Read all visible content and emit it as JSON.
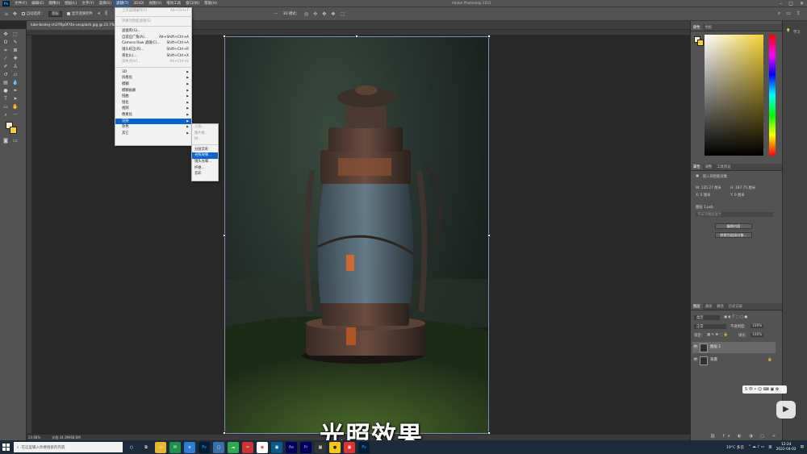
{
  "app": {
    "window_title": "Adobe Photoshop 2022",
    "logo_text": "Ps"
  },
  "menubar": [
    "文件(F)",
    "编辑(E)",
    "图像(I)",
    "图层(L)",
    "文字(Y)",
    "选择(S)",
    "滤镜(T)",
    "3D(D)",
    "视图(V)",
    "增效工具",
    "窗口(W)",
    "帮助(H)"
  ],
  "options": {
    "auto_select": "自动选择：",
    "layer_dd": "图层",
    "show_transform": "显示变换控件",
    "mode3d": "3D 模式："
  },
  "document": {
    "tab": "luke-besley-ch2YRp0f74o-unsplash.jpg @ 23.7% (图层 1, RGB/8#) *",
    "zoom": "23.68%",
    "doc_info": "文档:34.3M/68.6M"
  },
  "filter_menu": {
    "top": [
      {
        "label": "上次滤镜操作(F)",
        "shortcut": "Alt+Ctrl+F",
        "disabled": true
      },
      {
        "label": "转换为智能滤镜(S)",
        "shortcut": "",
        "disabled": true
      }
    ],
    "mid": [
      {
        "label": "滤镜库(G)...",
        "shortcut": ""
      },
      {
        "label": "自适应广角(A)...",
        "shortcut": "Alt+Shift+Ctrl+A"
      },
      {
        "label": "Camera Raw 滤镜(C)...",
        "shortcut": "Shift+Ctrl+A"
      },
      {
        "label": "镜头校正(R)...",
        "shortcut": "Shift+Ctrl+R"
      },
      {
        "label": "液化(L)...",
        "shortcut": "Shift+Ctrl+X"
      },
      {
        "label": "消失点(V)...",
        "shortcut": "Alt+Ctrl+V",
        "disabled": true
      }
    ],
    "sub": [
      "3D",
      "风格化",
      "模糊",
      "模糊画廊",
      "扭曲",
      "锐化",
      "视频",
      "像素化",
      "渲染",
      "杂色",
      "其它"
    ],
    "highlighted": "渲染"
  },
  "render_submenu": {
    "items": [
      "火焰...",
      "图片框...",
      "树...",
      "分层云彩",
      "光照效果...",
      "镜头光晕...",
      "纤维...",
      "云彩"
    ],
    "disabled_count": 3,
    "highlighted": "光照效果..."
  },
  "subtitle": "光照效果",
  "panels": {
    "color_tabs": [
      "颜色",
      "色板"
    ],
    "props_tabs": [
      "属性",
      "调整",
      "工具预设"
    ],
    "props_type": "嵌入的智能对象",
    "w": "W: 135.27 厘米",
    "h": "H: 187.75 厘米",
    "x": "X: 0 厘米",
    "y": "Y: 0 厘米",
    "layer_comp": "图层 1.psb",
    "comp_hint": "不支持图层复合",
    "edit_contents": "编辑内容",
    "convert_layers": "转换为链接对象...",
    "layers_tabs": [
      "图层",
      "通道",
      "路径",
      "历史记录"
    ],
    "kind": "类型",
    "blend": "正常",
    "opacity": "不透明度:",
    "opacity_val": "100%",
    "lock": "锁定:",
    "fill": "填充:",
    "fill_val": "100%",
    "layers": [
      {
        "name": "图层 1",
        "selected": true
      },
      {
        "name": "背景",
        "selected": false
      }
    ]
  },
  "far_right": {
    "learn": "学习"
  },
  "taskbar": {
    "search_placeholder": "在这里输入你要搜索的内容",
    "weather": "19°C 多云",
    "time": "12:24",
    "date": "2022-04-02",
    "lang": "英"
  }
}
